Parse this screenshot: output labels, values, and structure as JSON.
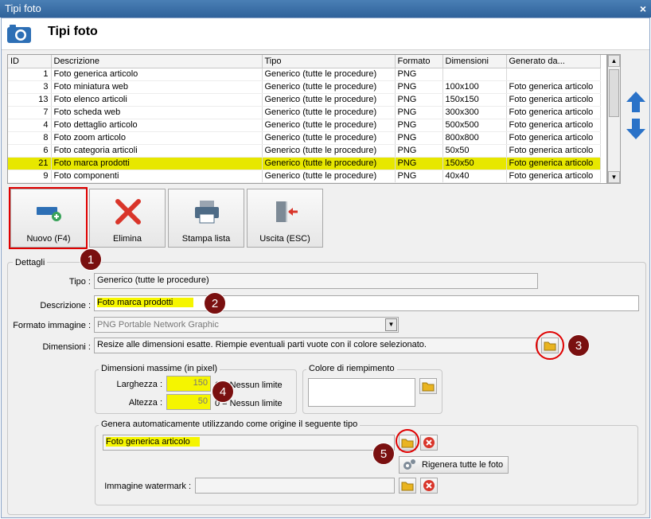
{
  "window": {
    "title": "Tipi foto",
    "close": "×"
  },
  "header": {
    "title": "Tipi foto"
  },
  "grid": {
    "columns": [
      "ID",
      "Descrizione",
      "Tipo",
      "Formato",
      "Dimensioni",
      "Generato da..."
    ],
    "rows": [
      [
        "1",
        "Foto generica articolo",
        "Generico (tutte le procedure)",
        "PNG",
        "",
        ""
      ],
      [
        "3",
        "Foto miniatura web",
        "Generico (tutte le procedure)",
        "PNG",
        "100x100",
        "Foto generica articolo"
      ],
      [
        "13",
        "Foto elenco articoli",
        "Generico (tutte le procedure)",
        "PNG",
        "150x150",
        "Foto generica articolo"
      ],
      [
        "7",
        "Foto scheda web",
        "Generico (tutte le procedure)",
        "PNG",
        "300x300",
        "Foto generica articolo"
      ],
      [
        "4",
        "Foto dettaglio articolo",
        "Generico (tutte le procedure)",
        "PNG",
        "500x500",
        "Foto generica articolo"
      ],
      [
        "8",
        "Foto zoom articolo",
        "Generico (tutte le procedure)",
        "PNG",
        "800x800",
        "Foto generica articolo"
      ],
      [
        "6",
        "Foto categoria articoli",
        "Generico (tutte le procedure)",
        "PNG",
        "50x50",
        "Foto generica articolo"
      ],
      [
        "21",
        "Foto marca prodotti",
        "Generico (tutte le procedure)",
        "PNG",
        "150x50",
        "Foto generica articolo"
      ],
      [
        "9",
        "Foto componenti",
        "Generico (tutte le procedure)",
        "PNG",
        "40x40",
        "Foto generica articolo"
      ]
    ],
    "selected_index": 7
  },
  "toolbar": {
    "new": "Nuovo (F4)",
    "delete": "Elimina",
    "print": "Stampa lista",
    "exit": "Uscita (ESC)"
  },
  "details": {
    "group_label": "Dettagli",
    "tipo_label": "Tipo :",
    "tipo_value": "Generico (tutte le procedure)",
    "descrizione_label": "Descrizione :",
    "descrizione_value": "Foto marca prodotti",
    "formato_label": "Formato immagine :",
    "formato_value": "PNG Portable Network Graphic",
    "dimensioni_label": "Dimensioni :",
    "dimensioni_value": "Resize alle dimensioni esatte. Riempie eventuali parti vuote con il colore selezionato.",
    "dim_max": {
      "group_label": "Dimensioni massime (in pixel)",
      "larghezza_label": "Larghezza :",
      "larghezza_value": "150",
      "altezza_label": "Altezza :",
      "altezza_value": "50",
      "hint1": "0 = Nessun limite",
      "hint2": "0 = Nessun limite"
    },
    "colore": {
      "group_label": "Colore di riempimento"
    },
    "genera": {
      "group_label": "Genera automaticamente utilizzando come origine il seguente tipo",
      "source_value": "Foto generica articolo",
      "rigenera_label": "Rigenera tutte le foto",
      "watermark_label": "Immagine watermark :",
      "watermark_value": ""
    }
  },
  "annotations": [
    "1",
    "2",
    "3",
    "4",
    "5"
  ],
  "colors": {
    "highlight": "#f5f500",
    "selected_row": "#e7e700",
    "callout": "#7a1010",
    "frame": "#e00000",
    "arrow": "#2a72c8"
  }
}
